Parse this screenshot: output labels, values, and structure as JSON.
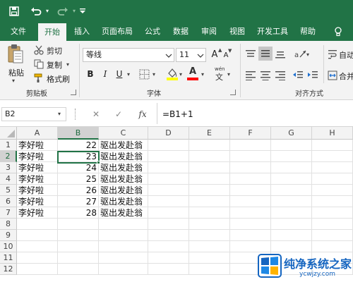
{
  "qat": {
    "save_icon": "save-icon",
    "undo_icon": "undo-icon",
    "redo_icon": "redo-icon",
    "customize_icon": "customize-qat-icon"
  },
  "tabs": [
    "文件",
    "开始",
    "插入",
    "页面布局",
    "公式",
    "数据",
    "审阅",
    "视图",
    "开发工具",
    "帮助"
  ],
  "tell_me_icon": "lightbulb-icon",
  "ribbon": {
    "clipboard": {
      "paste": "粘贴",
      "cut": "剪切",
      "copy": "复制",
      "format_painter": "格式刷",
      "label": "剪贴板"
    },
    "font": {
      "name": "等线",
      "size": "11",
      "bold": "B",
      "italic": "I",
      "underline": "U",
      "grow": "A",
      "shrink": "A",
      "wen": "wén",
      "wen_char": "文",
      "font_color_letter": "A",
      "fill_color": "#ffff00",
      "font_color": "#ff0000",
      "label": "字体"
    },
    "alignment": {
      "wrap": "自动",
      "merge": "合并",
      "label": "对齐方式"
    }
  },
  "formula_bar": {
    "name_box": "B2",
    "cancel": "✕",
    "enter": "✓",
    "fx": "fx",
    "formula": "=B1+1"
  },
  "grid": {
    "columns": [
      "A",
      "B",
      "C",
      "D",
      "E",
      "F",
      "G",
      "H"
    ],
    "selected_column": "B",
    "selected_row": "2",
    "rows": [
      {
        "n": "1",
        "a": "李好啦",
        "b": "22",
        "c": "驱出发赴翁"
      },
      {
        "n": "2",
        "a": "李好啦",
        "b": "23",
        "c": "驱出发赴翁"
      },
      {
        "n": "3",
        "a": "李好啦",
        "b": "24",
        "c": "驱出发赴翁"
      },
      {
        "n": "4",
        "a": "李好啦",
        "b": "25",
        "c": "驱出发赴翁"
      },
      {
        "n": "5",
        "a": "李好啦",
        "b": "26",
        "c": "驱出发赴翁"
      },
      {
        "n": "6",
        "a": "李好啦",
        "b": "27",
        "c": "驱出发赴翁"
      },
      {
        "n": "7",
        "a": "李好啦",
        "b": "28",
        "c": "驱出发赴翁"
      },
      {
        "n": "8",
        "a": "",
        "b": "",
        "c": ""
      },
      {
        "n": "9",
        "a": "",
        "b": "",
        "c": ""
      },
      {
        "n": "10",
        "a": "",
        "b": "",
        "c": ""
      },
      {
        "n": "11",
        "a": "",
        "b": "",
        "c": ""
      },
      {
        "n": "12",
        "a": "",
        "b": "",
        "c": ""
      }
    ]
  },
  "watermark": {
    "title": "纯净系统之家",
    "url": "ycwjzy.com",
    "accent": "#1565c0"
  },
  "colors": {
    "excel_green": "#217346",
    "header_gray": "#f3f3f3"
  }
}
